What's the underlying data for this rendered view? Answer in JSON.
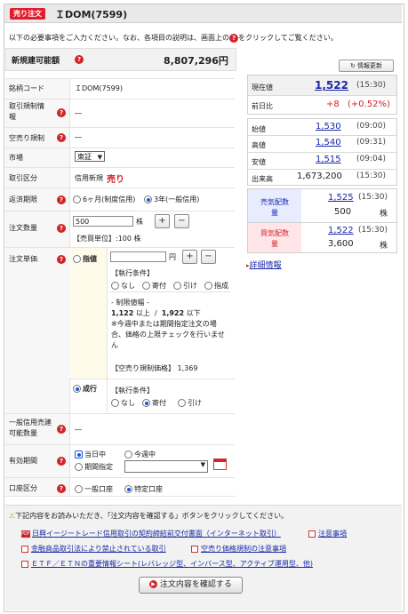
{
  "header": {
    "badge": "売り注文",
    "title": "ＩDOM(7599)"
  },
  "intro": {
    "text_before": "以下の必要事項をご入力ください。なお、各項目の説明は、画面上の",
    "text_after": "をクリックしてご覧ください。"
  },
  "buying_power": {
    "label": "新規建可能額",
    "value": "8,807,296円"
  },
  "refresh_button": "情報更新",
  "form": {
    "code": {
      "label": "銘柄コード",
      "value": "ＩDOM(7599)"
    },
    "margin_regulation": {
      "label": "取引規制情報",
      "value": "―"
    },
    "short_regulation": {
      "label": "空売り規制",
      "value": "―"
    },
    "market": {
      "label": "市場",
      "value": "東証"
    },
    "trade_type": {
      "label": "取引区分",
      "prefix": "信用新規",
      "value": "売り"
    },
    "repay_term": {
      "label": "返済期限",
      "opt1": "6ヶ月(制度信用)",
      "opt2": "3年(一般信用)"
    },
    "quantity": {
      "label": "注文数量",
      "value": "500",
      "unit": "株",
      "sale_unit": "【売買単位】:100 株"
    },
    "price": {
      "label": "注文単価",
      "limit_label": "指値",
      "yen": "円",
      "exec_cond": "【執行条件】",
      "cond_opts": [
        "なし",
        "寄付",
        "引け",
        "指成"
      ],
      "range_title": "- 制限値幅 -",
      "range_low": "1,122",
      "range_high": "1,922",
      "range_low_suffix": "以上",
      "range_sep": "/",
      "range_high_suffix": "以下",
      "range_note": "※今週中または期間指定注文の場合、価格の上限チェックを行いません",
      "short_price_label": "【空売り規制価格】",
      "short_price_value": "1,369",
      "market_label": "成行",
      "market_cond_opts": [
        "なし",
        "寄付",
        "引け"
      ]
    },
    "general_margin": {
      "label": "一般信用売建可能数量",
      "value": "―"
    },
    "validity": {
      "label": "有効期間",
      "opt1": "当日中",
      "opt2": "今週中",
      "opt3": "期間指定"
    },
    "account": {
      "label": "口座区分",
      "opt1": "一般口座",
      "opt2": "特定口座"
    }
  },
  "quote": {
    "current": {
      "label": "現在値",
      "value": "1,522",
      "time": "(15:30)"
    },
    "change": {
      "label": "前日比",
      "value": "+8",
      "pct": "(+0.52%)"
    },
    "open": {
      "label": "始値",
      "value": "1,530",
      "time": "(09:00)"
    },
    "high": {
      "label": "高値",
      "value": "1,540",
      "time": "(09:31)"
    },
    "low": {
      "label": "安値",
      "value": "1,515",
      "time": "(09:04)"
    },
    "volume": {
      "label": "出来高",
      "value": "1,673,200",
      "time": "(15:30)"
    },
    "ask": {
      "label": "売気配数量",
      "price": "1,525",
      "time": "(15:30)",
      "qty": "500",
      "unit": "株"
    },
    "bid": {
      "label": "買気配数量",
      "price": "1,522",
      "time": "(15:30)",
      "qty": "3,600",
      "unit": "株"
    },
    "detail_link": "詳細情報"
  },
  "footer": {
    "notice": "下記内容をお読みいただき、「注文内容を確認する」ボタンをクリックしてください。",
    "pdf_badge": "PDF",
    "links": [
      "日興イージートレード信用取引の契約締結前交付書面（インターネット取引）",
      "注意事項",
      "金融商品取引法により禁止されている取引",
      "空売り価格規制の注意事項",
      "ＥＴＦ／ＥＴＮの重要情報シート(レバレッジ型、インバース型、アクティブ運用型、他)"
    ],
    "confirm_button": "注文内容を確認する"
  },
  "colors": {
    "accent_red": "#d2232a",
    "link_blue": "#1a2aa6",
    "ask_bg": "#e8ecff",
    "bid_bg": "#ffe5e7"
  }
}
